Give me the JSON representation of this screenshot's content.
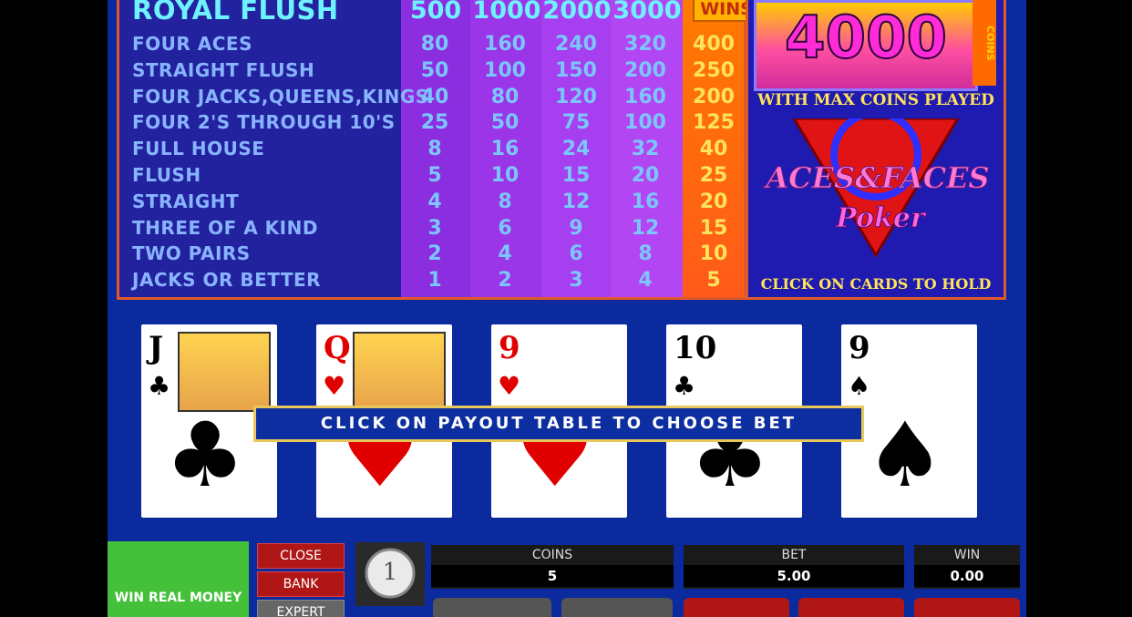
{
  "paytable": {
    "coin_headers": [
      "500",
      "1000",
      "2000",
      "3000"
    ],
    "wins_header": "WINS",
    "rows": [
      {
        "hand": "ROYAL FLUSH",
        "pays": [],
        "win": ""
      },
      {
        "hand": "FOUR ACES",
        "pays": [
          "80",
          "160",
          "240",
          "320"
        ],
        "win": "400"
      },
      {
        "hand": "STRAIGHT FLUSH",
        "pays": [
          "50",
          "100",
          "150",
          "200"
        ],
        "win": "250"
      },
      {
        "hand": "FOUR JACKS,QUEENS,KINGS",
        "pays": [
          "40",
          "80",
          "120",
          "160"
        ],
        "win": "200"
      },
      {
        "hand": "FOUR 2'S THROUGH 10'S",
        "pays": [
          "25",
          "50",
          "75",
          "100"
        ],
        "win": "125"
      },
      {
        "hand": "FULL HOUSE",
        "pays": [
          "8",
          "16",
          "24",
          "32"
        ],
        "win": "40"
      },
      {
        "hand": "FLUSH",
        "pays": [
          "5",
          "10",
          "15",
          "20"
        ],
        "win": "25"
      },
      {
        "hand": "STRAIGHT",
        "pays": [
          "4",
          "8",
          "12",
          "16"
        ],
        "win": "20"
      },
      {
        "hand": "THREE OF A KIND",
        "pays": [
          "3",
          "6",
          "9",
          "12"
        ],
        "win": "15"
      },
      {
        "hand": "TWO PAIRS",
        "pays": [
          "2",
          "4",
          "6",
          "8"
        ],
        "win": "10"
      },
      {
        "hand": "JACKS OR BETTER",
        "pays": [
          "1",
          "2",
          "3",
          "4"
        ],
        "win": "5"
      }
    ]
  },
  "jackpot": {
    "amount": "4000",
    "coins_label": "COINS",
    "max_coins": "WITH MAX COINS PLAYED"
  },
  "logo": {
    "title": "ACES&FACES",
    "subtitle": "Poker"
  },
  "hold_hint": "CLICK ON CARDS TO HOLD",
  "bet_banner": "CLICK ON PAYOUT TABLE TO CHOOSE BET",
  "cards": [
    {
      "rank": "J",
      "suit": "♣",
      "color": "black",
      "face": true
    },
    {
      "rank": "Q",
      "suit": "♥",
      "color": "red",
      "face": true
    },
    {
      "rank": "9",
      "suit": "♥",
      "color": "red",
      "face": false
    },
    {
      "rank": "10",
      "suit": "♣",
      "color": "black",
      "face": false
    },
    {
      "rank": "9",
      "suit": "♠",
      "color": "black",
      "face": false
    }
  ],
  "controls": {
    "win_real_money": "WIN REAL MONEY",
    "close": "CLOSE",
    "bank": "BANK",
    "expert": "EXPERT",
    "coin_value": "1",
    "coins_label": "COINS",
    "coins_value": "5",
    "bet_label": "BET",
    "bet_value": "5.00",
    "win_label": "WIN",
    "win_value": "0.00"
  },
  "colors": {
    "background": "#0a2a9e",
    "paytable_border": "#e0592a",
    "wins_column": "#ff8a00",
    "coin_column": "#9b2fe0",
    "win_real_money": "#44c03b",
    "side_buttons": "#b01616"
  }
}
